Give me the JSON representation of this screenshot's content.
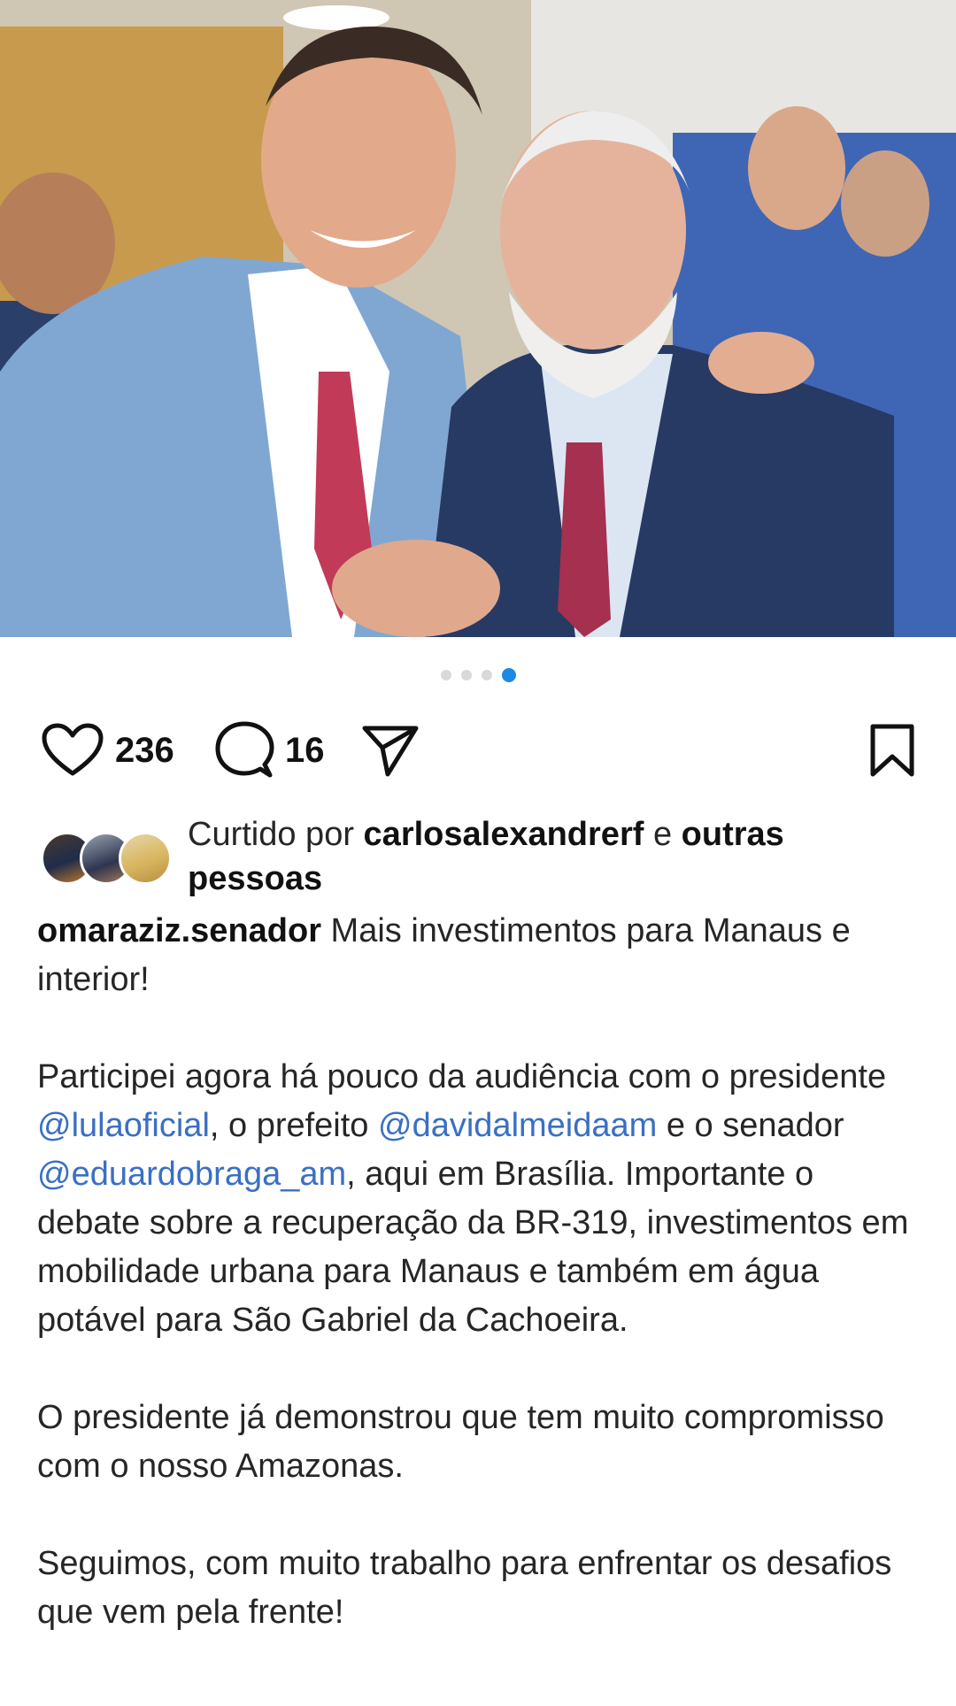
{
  "post": {
    "image_alt": "Photo of two smiling men in suits embracing",
    "carousel": {
      "total": 4,
      "active": 4
    },
    "colors": {
      "accent": "#1e88e5",
      "mention": "#3a6fc4"
    }
  },
  "actions": {
    "like_count": "236",
    "comment_count": "16",
    "like_icon": "heart-icon",
    "comment_icon": "comment-icon",
    "share_icon": "send-icon",
    "save_icon": "bookmark-icon"
  },
  "liked_by": {
    "prefix": "Curtido por ",
    "user": "carlosalexandrerf",
    "conj": " e ",
    "others": "outras pessoas"
  },
  "caption": {
    "username": "omaraziz.senador",
    "line1": " Mais investimentos para Manaus e interior!",
    "p2_a": "Participei agora há pouco da audiência com o presidente ",
    "mention1": "@lulaoficial",
    "p2_b": ", o prefeito ",
    "mention2": "@davidalmeidaam",
    "p2_c": " e o senador ",
    "mention3": "@eduardobraga_am",
    "p2_d": ", aqui em Brasília. Importante o debate sobre a recuperação da BR-319, investimentos em mobilidade urbana para Manaus e também em água potável para São Gabriel da Cachoeira.",
    "p3": "O presidente já demonstrou que tem muito compromisso com o nosso Amazonas.",
    "p4": "Seguimos, com muito trabalho para enfrentar os desafios que vem pela frente!"
  }
}
